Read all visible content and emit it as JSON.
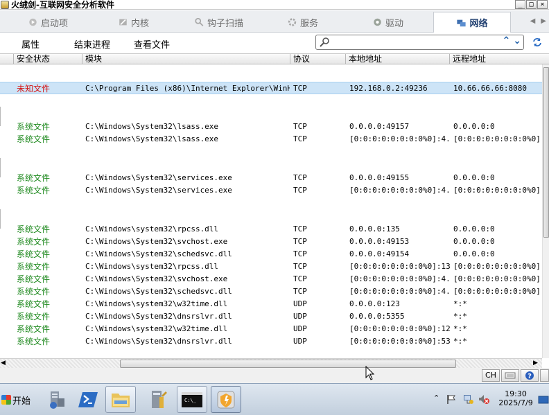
{
  "window": {
    "title": "火绒剑-互联网安全分析软件",
    "buttons": [
      "_",
      "□",
      "×"
    ]
  },
  "tabs": [
    {
      "label": "启动项",
      "icon": "startup-icon"
    },
    {
      "label": "内核",
      "icon": "kernel-icon"
    },
    {
      "label": "钩子扫描",
      "icon": "hook-scan-icon"
    },
    {
      "label": "服务",
      "icon": "service-icon"
    },
    {
      "label": "驱动",
      "icon": "driver-icon"
    },
    {
      "label": "网络",
      "icon": "network-icon",
      "active": true
    }
  ],
  "toolbar": {
    "properties": "属性",
    "end_process": "结束进程",
    "view_file": "查看文件",
    "search_value": "",
    "search_placeholder": ""
  },
  "columns": [
    "安全状态",
    "模块",
    "协议",
    "本地地址",
    "远程地址"
  ],
  "rows": [
    {
      "status": "未知文件",
      "module": "C:\\Program Files (x86)\\Internet Explorer\\WinHe...",
      "proto": "TCP",
      "local": "192.168.0.2:49236",
      "remote": "10.66.66.66:8080",
      "kind": "unknown",
      "selected": true
    },
    {
      "status": "系统文件",
      "module": "C:\\Windows\\System32\\lsass.exe",
      "proto": "TCP",
      "local": "0.0.0.0:49157",
      "remote": "0.0.0.0:0",
      "kind": "system"
    },
    {
      "status": "系统文件",
      "module": "C:\\Windows\\System32\\lsass.exe",
      "proto": "TCP",
      "local": "[0:0:0:0:0:0:0:0%0]:4...",
      "remote": "[0:0:0:0:0:0:0:0%0]:0",
      "kind": "system"
    },
    {
      "status": "系统文件",
      "module": "C:\\Windows\\System32\\services.exe",
      "proto": "TCP",
      "local": "0.0.0.0:49155",
      "remote": "0.0.0.0:0",
      "kind": "system"
    },
    {
      "status": "系统文件",
      "module": "C:\\Windows\\System32\\services.exe",
      "proto": "TCP",
      "local": "[0:0:0:0:0:0:0:0%0]:4...",
      "remote": "[0:0:0:0:0:0:0:0%0]:0",
      "kind": "system"
    },
    {
      "status": "系统文件",
      "module": "C:\\Windows\\system32\\rpcss.dll",
      "proto": "TCP",
      "local": "0.0.0.0:135",
      "remote": "0.0.0.0:0",
      "kind": "system"
    },
    {
      "status": "系统文件",
      "module": "C:\\Windows\\System32\\svchost.exe",
      "proto": "TCP",
      "local": "0.0.0.0:49153",
      "remote": "0.0.0.0:0",
      "kind": "system"
    },
    {
      "status": "系统文件",
      "module": "C:\\Windows\\System32\\schedsvc.dll",
      "proto": "TCP",
      "local": "0.0.0.0:49154",
      "remote": "0.0.0.0:0",
      "kind": "system"
    },
    {
      "status": "系统文件",
      "module": "C:\\Windows\\system32\\rpcss.dll",
      "proto": "TCP",
      "local": "[0:0:0:0:0:0:0:0%0]:135",
      "remote": "[0:0:0:0:0:0:0:0%0]:0",
      "kind": "system"
    },
    {
      "status": "系统文件",
      "module": "C:\\Windows\\System32\\svchost.exe",
      "proto": "TCP",
      "local": "[0:0:0:0:0:0:0:0%0]:4...",
      "remote": "[0:0:0:0:0:0:0:0%0]:0",
      "kind": "system"
    },
    {
      "status": "系统文件",
      "module": "C:\\Windows\\System32\\schedsvc.dll",
      "proto": "TCP",
      "local": "[0:0:0:0:0:0:0:0%0]:4...",
      "remote": "[0:0:0:0:0:0:0:0%0]:0",
      "kind": "system"
    },
    {
      "status": "系统文件",
      "module": "C:\\Windows\\system32\\w32time.dll",
      "proto": "UDP",
      "local": "0.0.0.0:123",
      "remote": "*:*",
      "kind": "system"
    },
    {
      "status": "系统文件",
      "module": "C:\\Windows\\System32\\dnsrslvr.dll",
      "proto": "UDP",
      "local": "0.0.0.0:5355",
      "remote": "*:*",
      "kind": "system"
    },
    {
      "status": "系统文件",
      "module": "C:\\Windows\\system32\\w32time.dll",
      "proto": "UDP",
      "local": "[0:0:0:0:0:0:0:0%0]:123",
      "remote": "*:*",
      "kind": "system"
    },
    {
      "status": "系统文件",
      "module": "C:\\Windows\\System32\\dnsrslvr.dll",
      "proto": "UDP",
      "local": "[0:0:0:0:0:0:0:0%0]:5355",
      "remote": "*:*",
      "kind": "system"
    }
  ],
  "ime": {
    "lang": "CH"
  },
  "taskbar": {
    "start_label": "开始",
    "clock_time": "19:30",
    "clock_date": "2025/7/9"
  },
  "colors": {
    "system_file": "#1f8a1f",
    "unknown_file": "#d41616",
    "selected_row": "#cde4f7",
    "accent": "#1d5ea8"
  }
}
